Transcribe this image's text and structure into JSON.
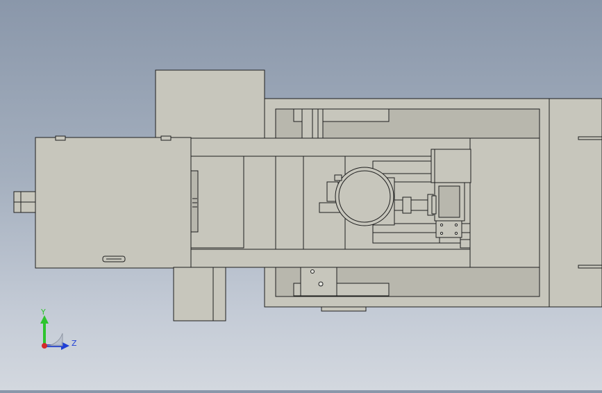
{
  "viewport": {
    "background_top": "#8a97aa",
    "background_bottom": "#d3d8df",
    "part_fill": "#c7c6bc",
    "edge_color": "#1e1e1e"
  },
  "triad": {
    "y_label": "Y",
    "z_label": "Z",
    "y_color": "#2ec42e",
    "z_color": "#1f3fd6",
    "x_color": "#d42a2a"
  }
}
